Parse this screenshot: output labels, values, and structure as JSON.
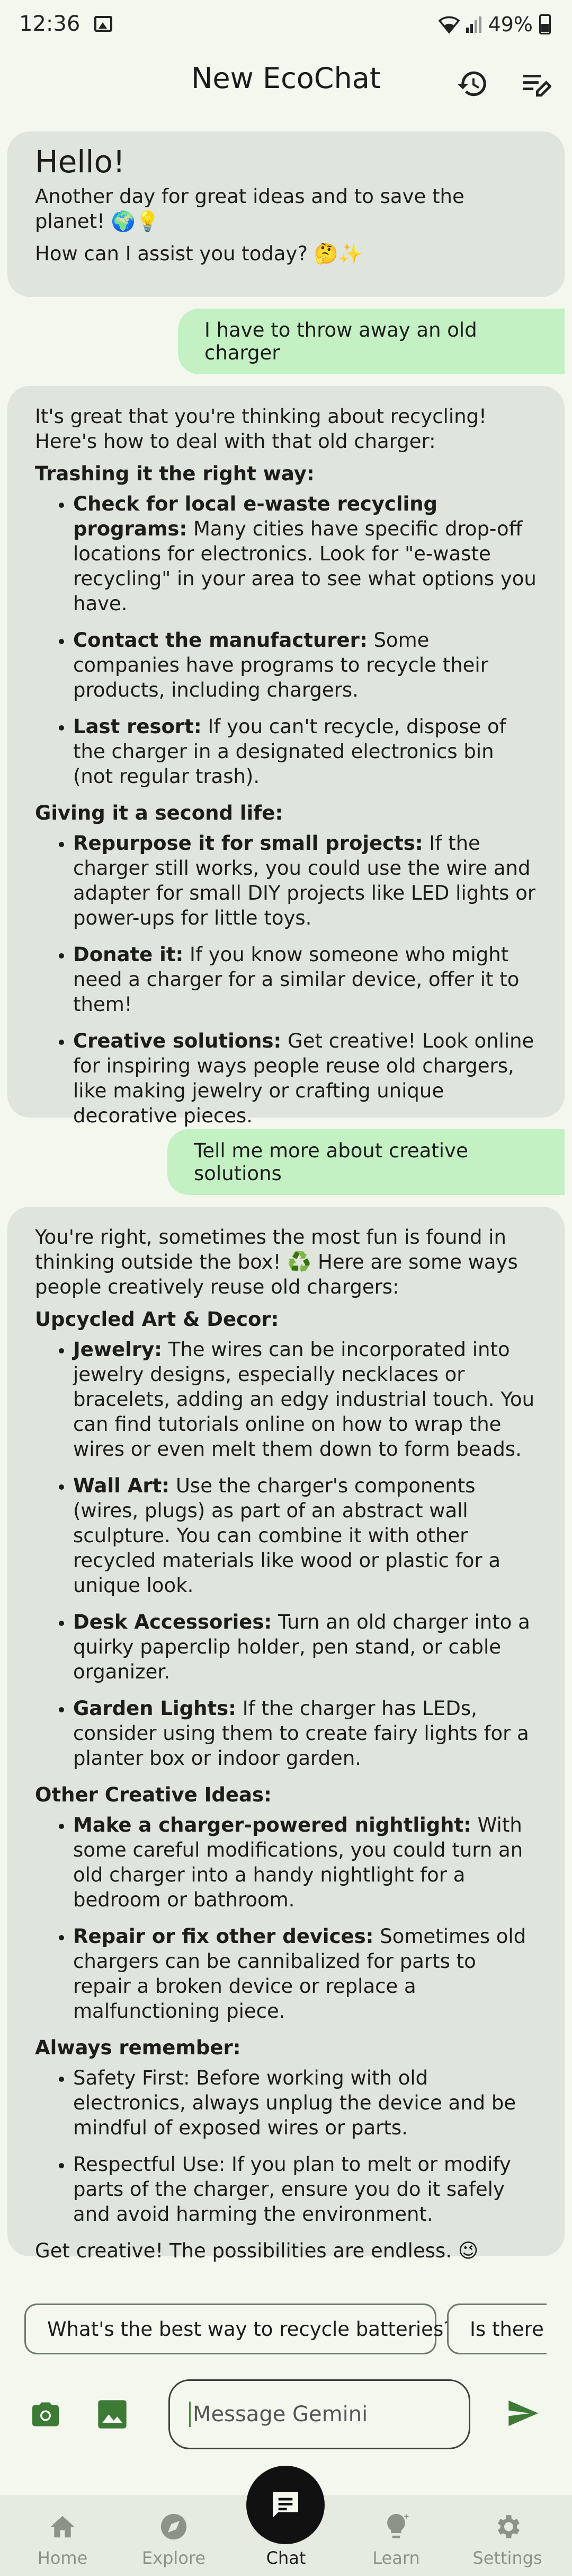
{
  "status": {
    "time": "12:36",
    "battery": "49%"
  },
  "header": {
    "title": "New EcoChat"
  },
  "messages": {
    "m1": {
      "greeting": "Hello!",
      "line1": "Another day for great ideas and to save the planet! 🌍💡",
      "line2": "How can I assist you today? 🤔✨"
    },
    "u1": "I have to throw away an old charger",
    "m2": {
      "intro": "It's great that you're thinking about recycling! Here's how to deal with that old charger:",
      "s1": "Trashing it the right way:",
      "s1_items": [
        {
          "b": "Check for local e-waste recycling programs:",
          "t": " Many cities have specific drop-off locations for electronics. Look for \"e-waste recycling\" in your area to see what options you have."
        },
        {
          "b": "Contact the manufacturer:",
          "t": " Some companies have programs to recycle their products, including chargers."
        },
        {
          "b": "Last resort:",
          "t": " If you can't recycle, dispose of the charger in a designated electronics bin (not regular trash)."
        }
      ],
      "s2": "Giving it a second life:",
      "s2_items": [
        {
          "b": "Repurpose it for small projects:",
          "t": "  If the charger still works, you could use the wire and adapter for small DIY projects like LED lights or power-ups for little toys."
        },
        {
          "b": "Donate it:",
          "t": "  If you know someone who might need a charger for a similar device, offer it to them!"
        },
        {
          "b": "Creative solutions:",
          "t": "  Get creative! Look online for inspiring ways people reuse old chargers, like making jewelry or crafting unique decorative pieces."
        }
      ]
    },
    "u2": "Tell me more about creative solutions",
    "m3": {
      "intro": "You're right, sometimes the most fun is found in thinking outside the box! ♻️ Here are some ways people creatively reuse old chargers:",
      "s1": "Upcycled Art & Decor:",
      "s1_items": [
        {
          "b": "Jewelry:",
          "t": "  The wires can be incorporated into jewelry designs, especially necklaces or bracelets, adding an edgy industrial touch. You can find tutorials online on how to wrap the wires or even melt them down to form beads."
        },
        {
          "b": "Wall Art:",
          "t": "   Use the charger's components (wires, plugs) as part of an abstract wall sculpture. You can combine it with other recycled materials like wood or plastic for a unique look."
        },
        {
          "b": "Desk Accessories:",
          "t": "  Turn an old charger into a quirky paperclip holder, pen stand, or cable organizer."
        },
        {
          "b": "Garden Lights:",
          "t": "  If the charger has LEDs, consider using them to create fairy lights for a planter box or indoor garden."
        }
      ],
      "s2": "Other Creative Ideas:",
      "s2_items": [
        {
          "b": "Make a charger-powered nightlight:",
          "t": " With some careful modifications, you could turn an old charger into a handy nightlight for a bedroom or bathroom."
        },
        {
          "b": "Repair or fix other devices:",
          "t": " Sometimes old chargers can be cannibalized for parts to repair a broken device or replace a malfunctioning piece."
        }
      ],
      "s3": "Always remember:",
      "s3_items": [
        "Safety First:  Before working with old electronics, always unplug the device and be mindful of exposed wires or parts.",
        "Respectful Use: If you plan to melt or modify parts of the charger, ensure you do it safely and avoid harming the environment."
      ],
      "outro": "Get creative! The possibilities are endless. 😉"
    }
  },
  "chips": [
    "What's the best way to recycle batteries?",
    "Is there c"
  ],
  "input": {
    "placeholder": "Message Gemini"
  },
  "nav": {
    "home": "Home",
    "explore": "Explore",
    "chat": "Chat",
    "learn": "Learn",
    "settings": "Settings"
  },
  "colors": {
    "accent": "#3d7a36",
    "user_bubble": "#c3f1c3",
    "bot_bubble": "#dfe4dc",
    "background": "#f3f7ee"
  }
}
